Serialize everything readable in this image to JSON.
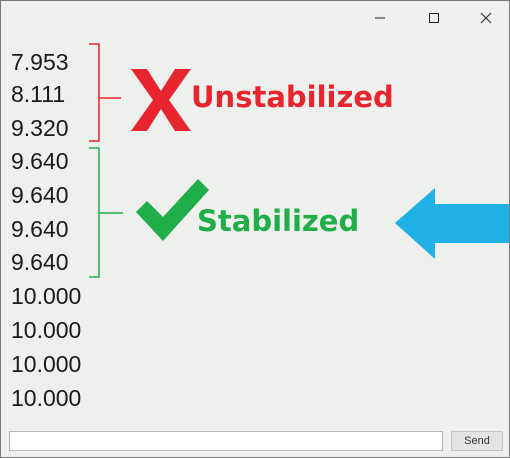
{
  "window": {
    "controls": {
      "minimize": "minimize-icon",
      "maximize": "maximize-icon",
      "close": "close-icon"
    }
  },
  "serial_output": {
    "lines": [
      "7.953",
      "8.111",
      "9.320",
      "9.640",
      "9.640",
      "9.640",
      "9.640",
      "10.000",
      "10.000",
      "10.000",
      "10.000"
    ]
  },
  "annotations": {
    "unstabilized": {
      "label": "Unstabilized",
      "icon": "x-mark-icon",
      "color": "#e8252f"
    },
    "stabilized": {
      "label": "Stabilized",
      "icon": "checkmark-icon",
      "color": "#1fae48"
    },
    "arrow": {
      "icon": "left-arrow-icon",
      "color": "#1fb0e6"
    }
  },
  "input_bar": {
    "value": "",
    "placeholder": "",
    "send_label": "Send"
  }
}
